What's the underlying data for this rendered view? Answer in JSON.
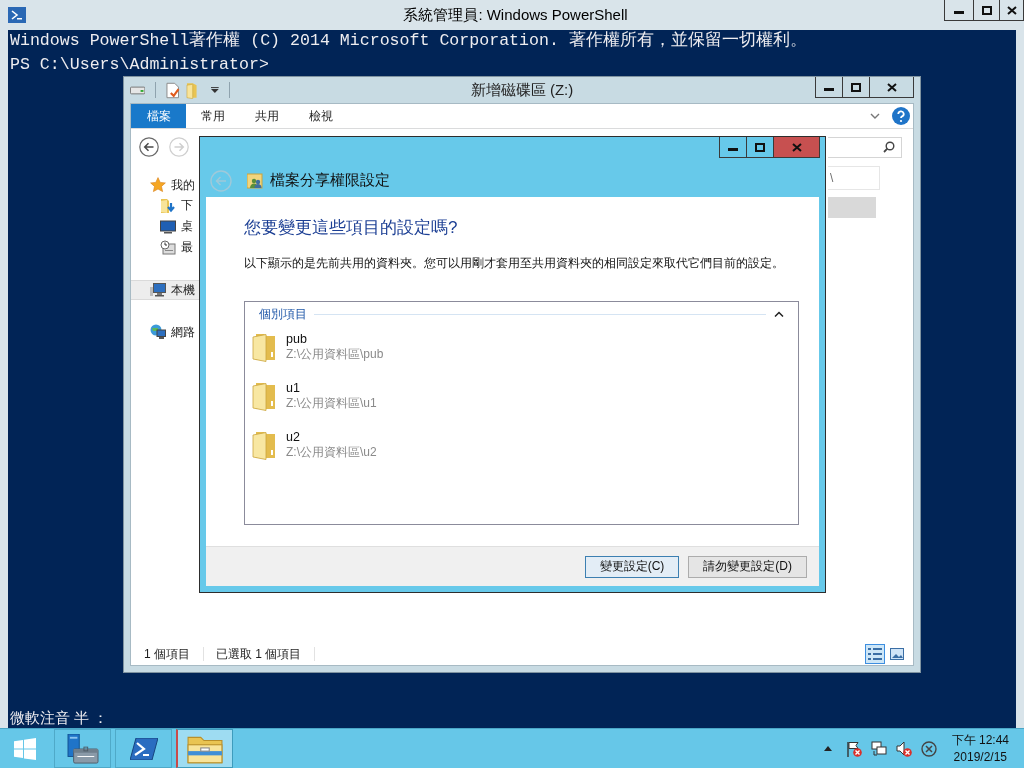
{
  "powershell": {
    "title": "系統管理員: Windows PowerShell",
    "lines": [
      "Windows PowerShell著作權 (C) 2014 Microsoft Corporation. 著作權所有，並保留一切權利。",
      "PS C:\\Users\\Administrator>"
    ],
    "ime_status": "微軟注音 半 ："
  },
  "explorer": {
    "title": "新增磁碟區 (Z:)",
    "tabs": [
      {
        "label": "檔案",
        "selected": true
      },
      {
        "label": "常用",
        "selected": false
      },
      {
        "label": "共用",
        "selected": false
      },
      {
        "label": "檢視",
        "selected": false
      }
    ],
    "nav_items": [
      {
        "label": "我的",
        "kind": "favorites",
        "selected": false,
        "children": [
          {
            "label": "下",
            "kind": "downloads",
            "selected": false
          },
          {
            "label": "桌",
            "kind": "desktop",
            "selected": false
          },
          {
            "label": "最",
            "kind": "recent",
            "selected": false
          }
        ]
      },
      {
        "label": "本機",
        "kind": "computer",
        "selected": true
      },
      {
        "label": "網路",
        "kind": "network",
        "selected": false
      }
    ],
    "rows": [
      {
        "column_1": "\\",
        "selected": false
      },
      {
        "selected": true
      }
    ],
    "status_items": [
      "1 個項目",
      "已選取 1 個項目"
    ],
    "views": [
      {
        "kind": "details",
        "selected": true
      },
      {
        "kind": "thumbnails",
        "selected": false
      }
    ]
  },
  "dialog": {
    "title": "檔案分享權限設定",
    "heading": "您要變更這些項目的設定嗎?",
    "description": "以下顯示的是先前共用的資料夾。您可以用剛才套用至共用資料夾的相同設定來取代它們目前的設定。",
    "group": {
      "label": "個別項目",
      "expanded": true
    },
    "items": [
      {
        "name": "pub",
        "path": "Z:\\公用資料區\\pub"
      },
      {
        "name": "u1",
        "path": "Z:\\公用資料區\\u1"
      },
      {
        "name": "u2",
        "path": "Z:\\公用資料區\\u2"
      }
    ],
    "buttons": [
      {
        "label": "變更設定(C)",
        "default": true
      },
      {
        "label": "請勿變更設定(D)",
        "default": false
      }
    ]
  },
  "taskbar": {
    "apps": [
      {
        "kind": "server-manager",
        "selected": false
      },
      {
        "kind": "powershell",
        "selected": false
      },
      {
        "kind": "explorer",
        "selected": true
      }
    ],
    "clock": {
      "time": "下午 12:44",
      "date": "2019/2/15"
    }
  }
}
